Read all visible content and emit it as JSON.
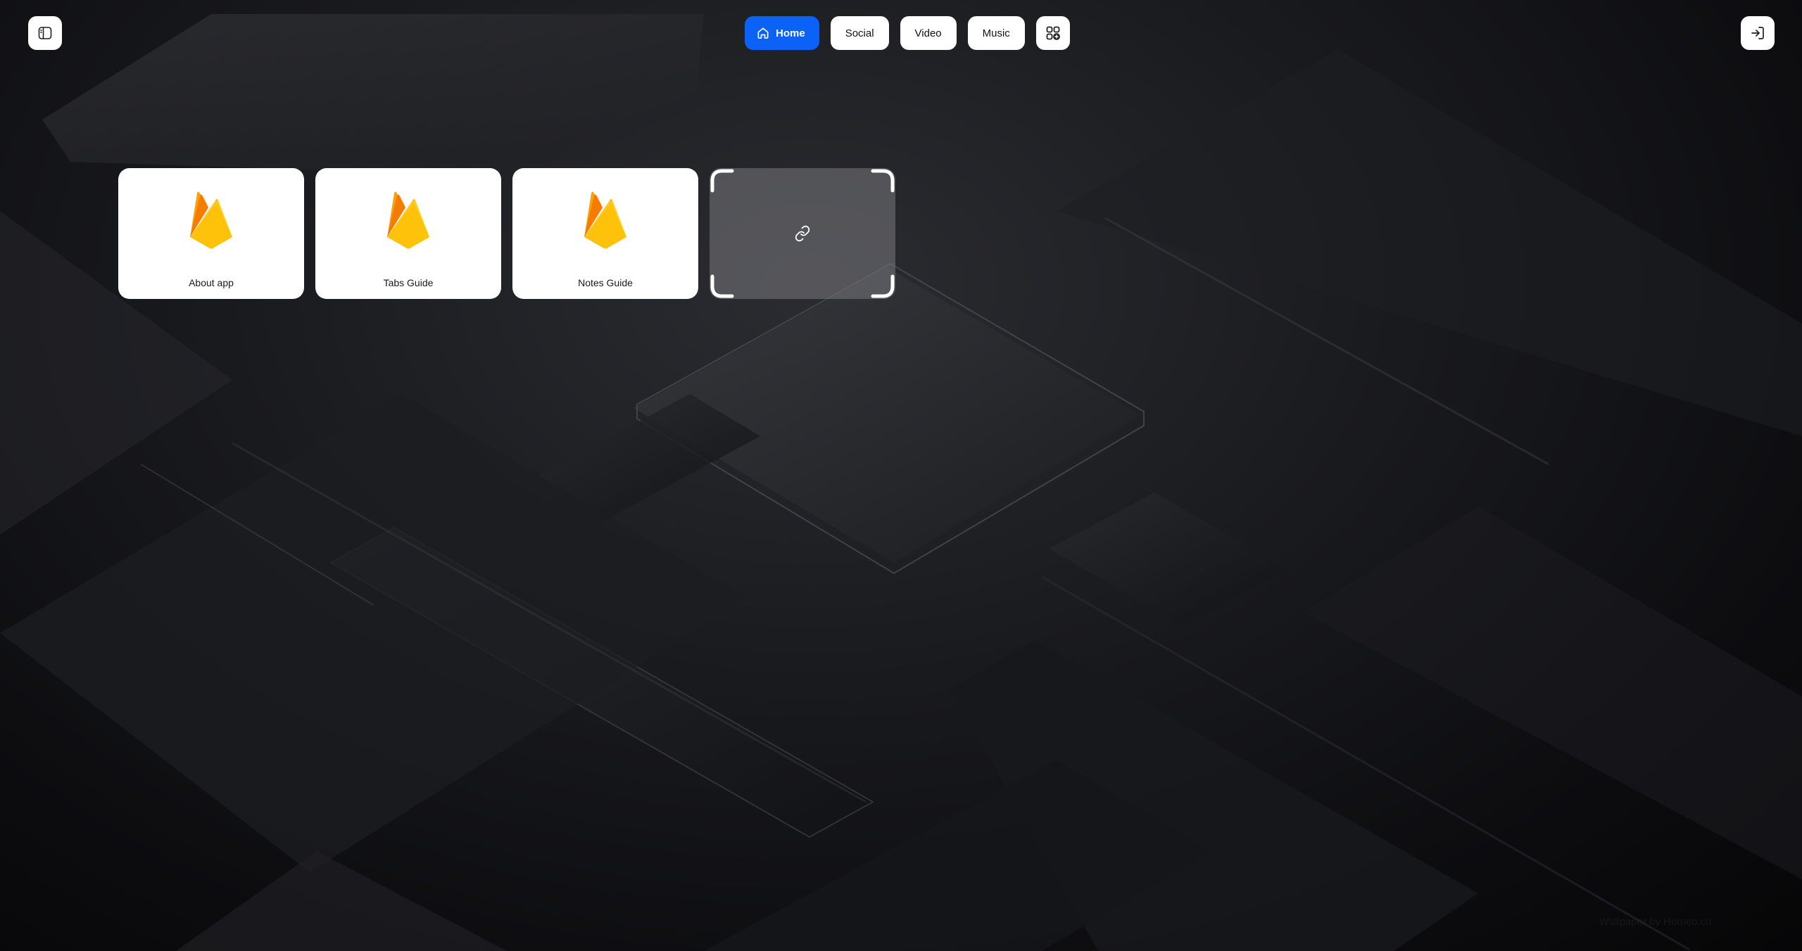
{
  "header": {
    "sidebar_toggle_icon": "sidebar-panel-icon",
    "login_icon": "sign-in-icon"
  },
  "tabs": [
    {
      "label": "Home",
      "icon": "home-icon",
      "active": true
    },
    {
      "label": "Social",
      "active": false
    },
    {
      "label": "Video",
      "active": false
    },
    {
      "label": "Music",
      "active": false
    }
  ],
  "apps_icon": "apps-grid-add-icon",
  "tiles": [
    {
      "label": "About app",
      "icon": "firebase-logo"
    },
    {
      "label": "Tabs Guide",
      "icon": "firebase-logo"
    },
    {
      "label": "Notes Guide",
      "icon": "firebase-logo"
    }
  ],
  "add_tile": {
    "icon": "link-icon"
  },
  "watermark": "Wallpaper by Homeo.co",
  "colors": {
    "accent": "#0a63f6",
    "tile_bg": "#ffffff",
    "firebase_light": "#ffca28",
    "firebase_mid": "#ffa000",
    "firebase_dark": "#f57c00"
  }
}
